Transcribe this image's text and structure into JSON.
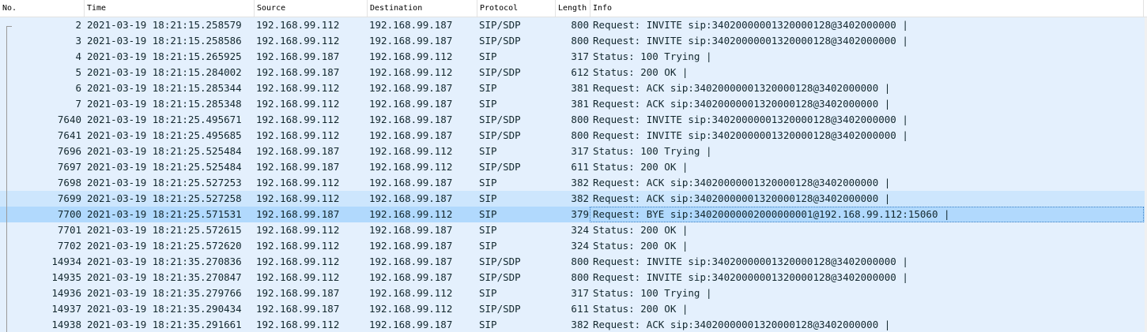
{
  "columns": [
    {
      "key": "no",
      "label": "No."
    },
    {
      "key": "time",
      "label": "Time"
    },
    {
      "key": "source",
      "label": "Source"
    },
    {
      "key": "destination",
      "label": "Destination"
    },
    {
      "key": "protocol",
      "label": "Protocol"
    },
    {
      "key": "length",
      "label": "Length"
    },
    {
      "key": "info",
      "label": "Info"
    }
  ],
  "rows": [
    {
      "no": "2",
      "time": "2021-03-19 18:21:15.258579",
      "source": "192.168.99.112",
      "destination": "192.168.99.187",
      "protocol": "SIP/SDP",
      "length": "800",
      "info": "Request: INVITE sip:34020000001320000128@3402000000 |"
    },
    {
      "no": "3",
      "time": "2021-03-19 18:21:15.258586",
      "source": "192.168.99.112",
      "destination": "192.168.99.187",
      "protocol": "SIP/SDP",
      "length": "800",
      "info": "Request: INVITE sip:34020000001320000128@3402000000 |"
    },
    {
      "no": "4",
      "time": "2021-03-19 18:21:15.265925",
      "source": "192.168.99.187",
      "destination": "192.168.99.112",
      "protocol": "SIP",
      "length": "317",
      "info": "Status: 100 Trying |"
    },
    {
      "no": "5",
      "time": "2021-03-19 18:21:15.284002",
      "source": "192.168.99.187",
      "destination": "192.168.99.112",
      "protocol": "SIP/SDP",
      "length": "612",
      "info": "Status: 200 OK |"
    },
    {
      "no": "6",
      "time": "2021-03-19 18:21:15.285344",
      "source": "192.168.99.112",
      "destination": "192.168.99.187",
      "protocol": "SIP",
      "length": "381",
      "info": "Request: ACK sip:34020000001320000128@3402000000 |"
    },
    {
      "no": "7",
      "time": "2021-03-19 18:21:15.285348",
      "source": "192.168.99.112",
      "destination": "192.168.99.187",
      "protocol": "SIP",
      "length": "381",
      "info": "Request: ACK sip:34020000001320000128@3402000000 |"
    },
    {
      "no": "7640",
      "time": "2021-03-19 18:21:25.495671",
      "source": "192.168.99.112",
      "destination": "192.168.99.187",
      "protocol": "SIP/SDP",
      "length": "800",
      "info": "Request: INVITE sip:34020000001320000128@3402000000 |"
    },
    {
      "no": "7641",
      "time": "2021-03-19 18:21:25.495685",
      "source": "192.168.99.112",
      "destination": "192.168.99.187",
      "protocol": "SIP/SDP",
      "length": "800",
      "info": "Request: INVITE sip:34020000001320000128@3402000000 |"
    },
    {
      "no": "7696",
      "time": "2021-03-19 18:21:25.525484",
      "source": "192.168.99.187",
      "destination": "192.168.99.112",
      "protocol": "SIP",
      "length": "317",
      "info": "Status: 100 Trying |"
    },
    {
      "no": "7697",
      "time": "2021-03-19 18:21:25.525484",
      "source": "192.168.99.187",
      "destination": "192.168.99.112",
      "protocol": "SIP/SDP",
      "length": "611",
      "info": "Status: 200 OK |"
    },
    {
      "no": "7698",
      "time": "2021-03-19 18:21:25.527253",
      "source": "192.168.99.112",
      "destination": "192.168.99.187",
      "protocol": "SIP",
      "length": "382",
      "info": "Request: ACK sip:34020000001320000128@3402000000 |"
    },
    {
      "no": "7699",
      "time": "2021-03-19 18:21:25.527258",
      "source": "192.168.99.112",
      "destination": "192.168.99.187",
      "protocol": "SIP",
      "length": "382",
      "info": "Request: ACK sip:34020000001320000128@3402000000 |"
    },
    {
      "no": "7700",
      "time": "2021-03-19 18:21:25.571531",
      "source": "192.168.99.187",
      "destination": "192.168.99.112",
      "protocol": "SIP",
      "length": "379",
      "info": "Request: BYE sip:34020000002000000001@192.168.99.112:15060 |"
    },
    {
      "no": "7701",
      "time": "2021-03-19 18:21:25.572615",
      "source": "192.168.99.112",
      "destination": "192.168.99.187",
      "protocol": "SIP",
      "length": "324",
      "info": "Status: 200 OK |"
    },
    {
      "no": "7702",
      "time": "2021-03-19 18:21:25.572620",
      "source": "192.168.99.112",
      "destination": "192.168.99.187",
      "protocol": "SIP",
      "length": "324",
      "info": "Status: 200 OK |"
    },
    {
      "no": "14934",
      "time": "2021-03-19 18:21:35.270836",
      "source": "192.168.99.112",
      "destination": "192.168.99.187",
      "protocol": "SIP/SDP",
      "length": "800",
      "info": "Request: INVITE sip:34020000001320000128@3402000000 |"
    },
    {
      "no": "14935",
      "time": "2021-03-19 18:21:35.270847",
      "source": "192.168.99.112",
      "destination": "192.168.99.187",
      "protocol": "SIP/SDP",
      "length": "800",
      "info": "Request: INVITE sip:34020000001320000128@3402000000 |"
    },
    {
      "no": "14936",
      "time": "2021-03-19 18:21:35.279766",
      "source": "192.168.99.187",
      "destination": "192.168.99.112",
      "protocol": "SIP",
      "length": "317",
      "info": "Status: 100 Trying |"
    },
    {
      "no": "14937",
      "time": "2021-03-19 18:21:35.290434",
      "source": "192.168.99.187",
      "destination": "192.168.99.112",
      "protocol": "SIP/SDP",
      "length": "611",
      "info": "Status: 200 OK |"
    },
    {
      "no": "14938",
      "time": "2021-03-19 18:21:35.291661",
      "source": "192.168.99.112",
      "destination": "192.168.99.187",
      "protocol": "SIP",
      "length": "382",
      "info": "Request: ACK sip:34020000001320000128@3402000000 |"
    }
  ],
  "selected_row_no": "7700",
  "hover_row_no": "7699",
  "colors": {
    "row_bg": "#e4f0fd",
    "hover_bg": "#cde6fd",
    "selected_bg": "#b1d9fd",
    "text": "#12272e",
    "header_border": "#e2e2e2"
  }
}
